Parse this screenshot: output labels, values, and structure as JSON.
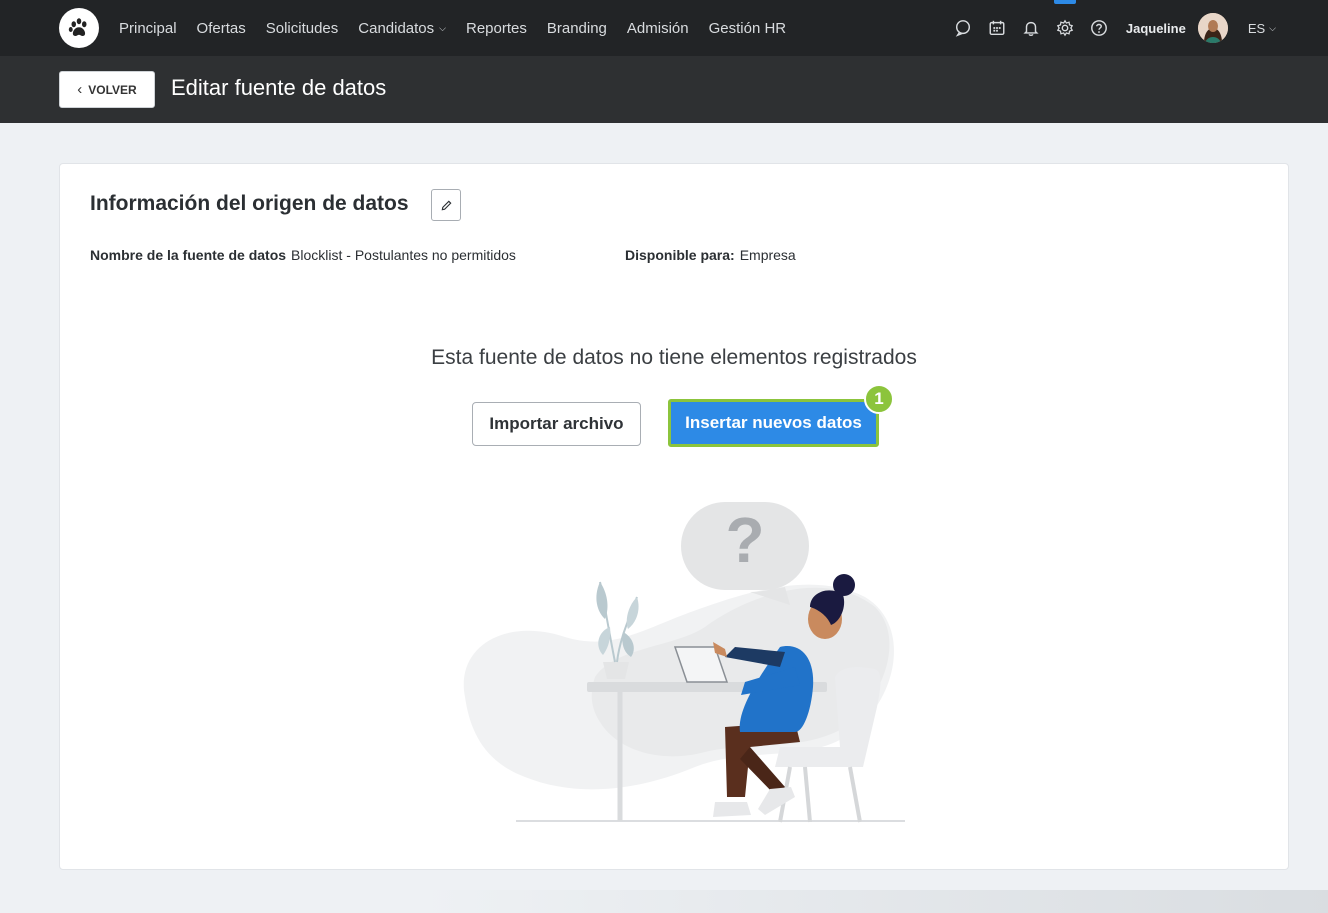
{
  "nav": {
    "items": [
      {
        "label": "Principal",
        "name": "nav-principal",
        "has_dropdown": false
      },
      {
        "label": "Ofertas",
        "name": "nav-ofertas",
        "has_dropdown": false
      },
      {
        "label": "Solicitudes",
        "name": "nav-solicitudes",
        "has_dropdown": false
      },
      {
        "label": "Candidatos",
        "name": "nav-candidatos",
        "has_dropdown": true
      },
      {
        "label": "Reportes",
        "name": "nav-reportes",
        "has_dropdown": false
      },
      {
        "label": "Branding",
        "name": "nav-branding",
        "has_dropdown": false
      },
      {
        "label": "Admisión",
        "name": "nav-admision",
        "has_dropdown": false
      },
      {
        "label": "Gestión HR",
        "name": "nav-gestion-hr",
        "has_dropdown": false
      }
    ],
    "icons": [
      "chat-icon",
      "calendar-icon",
      "bell-icon",
      "gear-icon",
      "help-icon"
    ],
    "active_icon": "gear-icon",
    "user_name": "Jaqueline",
    "language": "ES"
  },
  "header": {
    "back_label": "VOLVER",
    "title": "Editar fuente de datos"
  },
  "card": {
    "section_title": "Información del origen de datos",
    "source_name_label": "Nombre de la fuente de datos",
    "source_name_value": "Blocklist - Postulantes no permitidos",
    "available_label": "Disponible para:",
    "available_value": "Empresa",
    "empty_message": "Esta fuente de datos no tiene elementos registrados",
    "import_label": "Importar archivo",
    "insert_label": "Insertar nuevos datos",
    "step_number": "1"
  },
  "colors": {
    "nav_bg": "#222426",
    "header_bg": "#2e3032",
    "primary": "#2d8ae6",
    "highlight": "#8cc43c",
    "page_bg": "#eef1f4"
  }
}
